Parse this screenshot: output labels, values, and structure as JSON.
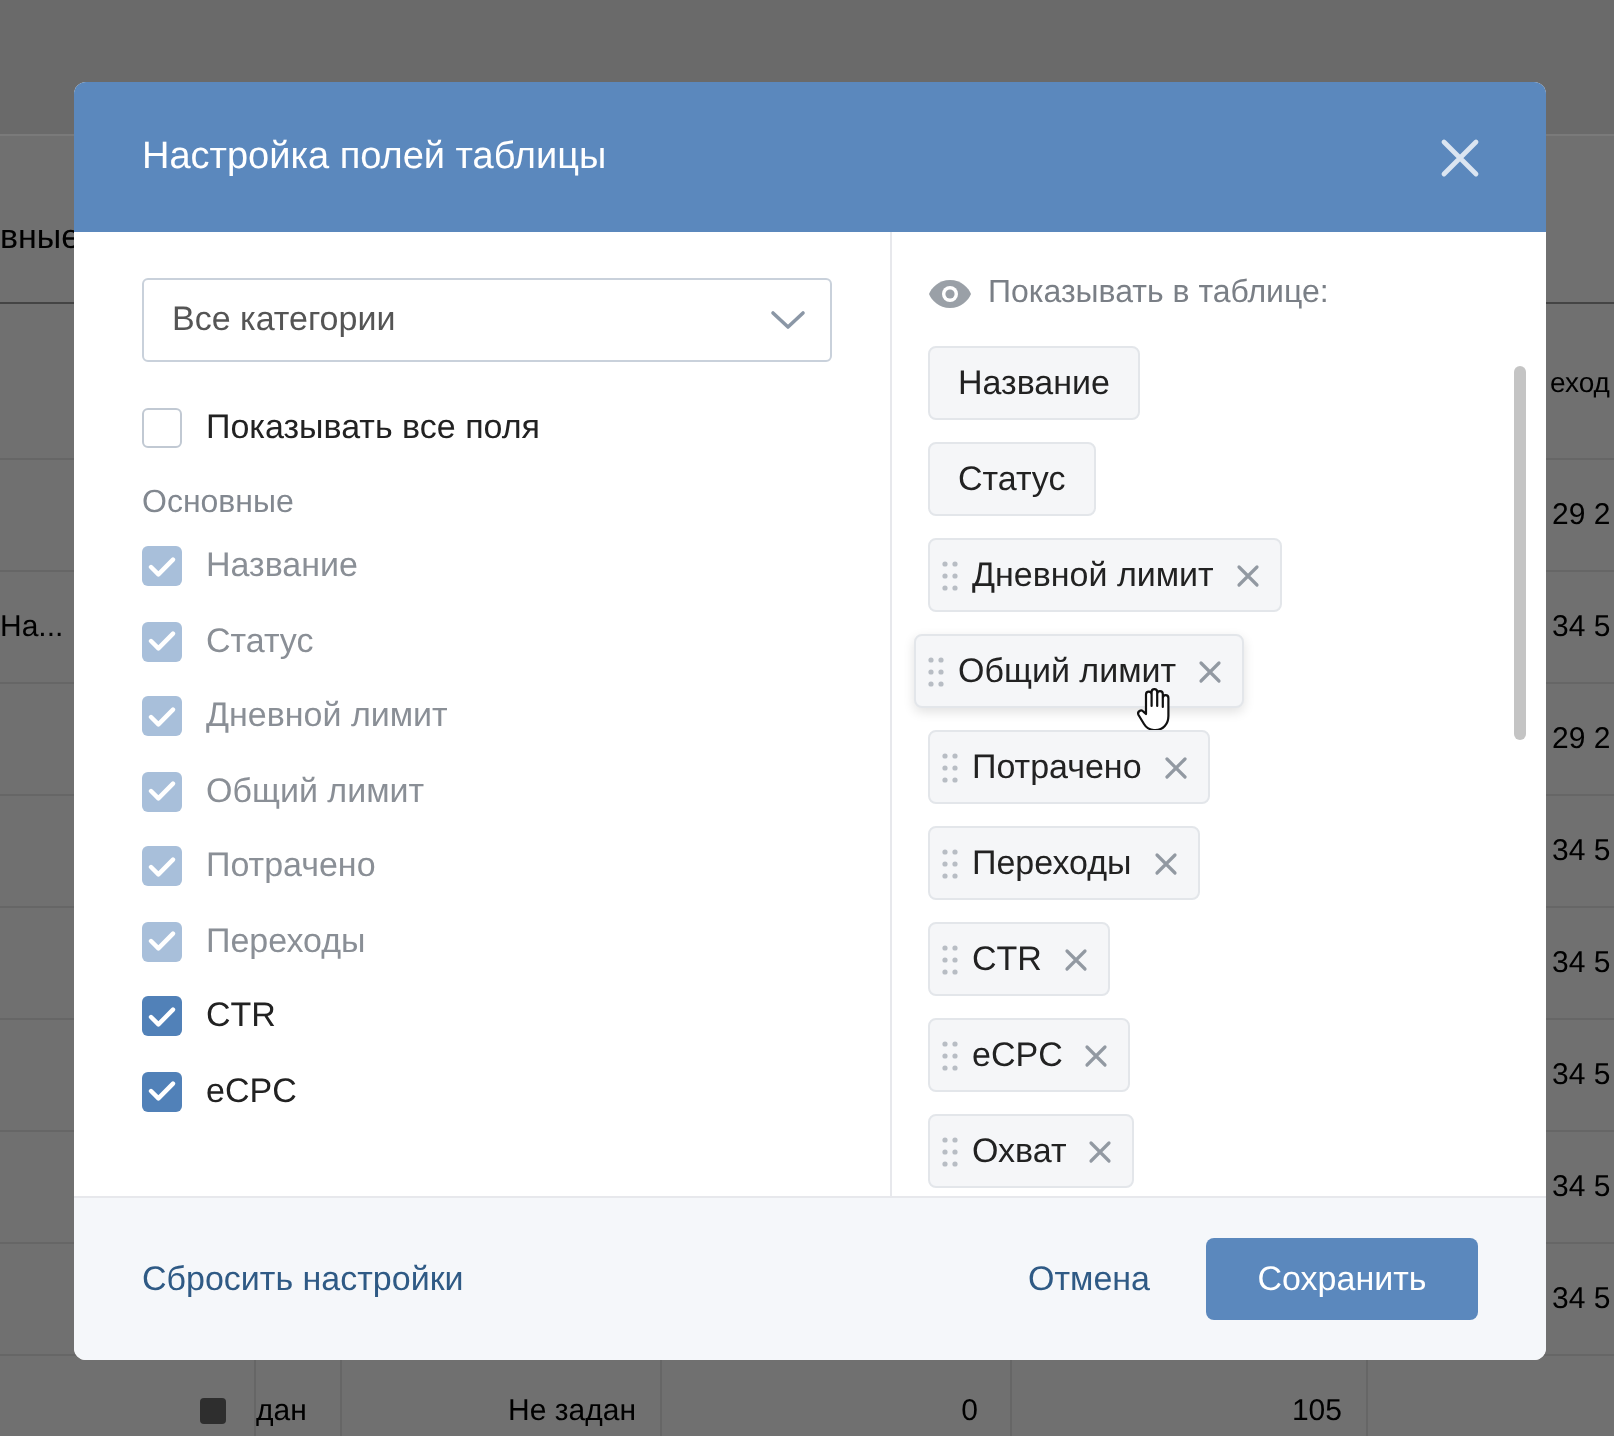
{
  "background_table": {
    "tab_label": "вные",
    "column_heading": "еход",
    "rows": [
      {
        "column_7": "29 2"
      },
      {
        "column_1": "На...",
        "column_7": "34 5"
      },
      {
        "column_7": "29 2"
      },
      {
        "column_7": "34 5"
      },
      {
        "column_7": "34 5"
      },
      {
        "column_7": "34 5"
      },
      {
        "column_7": "34 5"
      },
      {
        "column_7": "34 5"
      },
      {
        "column_3": "дан",
        "column_4": "Не задан",
        "column_5": "0",
        "column_6": "105"
      }
    ]
  },
  "dialog": {
    "title": "Настройка полей таблицы",
    "category_select": {
      "value": "Все категории"
    },
    "show_all": {
      "label": "Показывать все поля",
      "checked": false
    },
    "section_label": "Основные",
    "fields": [
      {
        "label": "Название",
        "checked": true,
        "disabled": true
      },
      {
        "label": "Статус",
        "checked": true,
        "disabled": true
      },
      {
        "label": "Дневной лимит",
        "checked": true,
        "disabled": true
      },
      {
        "label": "Общий лимит",
        "checked": true,
        "disabled": true
      },
      {
        "label": "Потрачено",
        "checked": true,
        "disabled": true
      },
      {
        "label": "Переходы",
        "checked": true,
        "disabled": true
      },
      {
        "label": "CTR",
        "checked": true,
        "disabled": false
      },
      {
        "label": "eCPC",
        "checked": true,
        "disabled": false
      }
    ],
    "visible_heading": "Показывать в таблице:",
    "visible_columns": [
      {
        "label": "Название",
        "kind": "fixed",
        "dragging": false
      },
      {
        "label": "Статус",
        "kind": "fixed",
        "dragging": false
      },
      {
        "label": "Дневной лимит",
        "kind": "removable",
        "dragging": false
      },
      {
        "label": "Общий лимит",
        "kind": "removable",
        "dragging": true
      },
      {
        "label": "Потрачено",
        "kind": "removable",
        "dragging": false
      },
      {
        "label": "Переходы",
        "kind": "removable",
        "dragging": false
      },
      {
        "label": "CTR",
        "kind": "removable",
        "dragging": false
      },
      {
        "label": "eCPC",
        "kind": "removable",
        "dragging": false
      },
      {
        "label": "Охват",
        "kind": "removable",
        "dragging": false
      }
    ],
    "reset_link": "Сбросить настройки",
    "cancel_button": "Отмена",
    "save_button": "Сохранить"
  }
}
